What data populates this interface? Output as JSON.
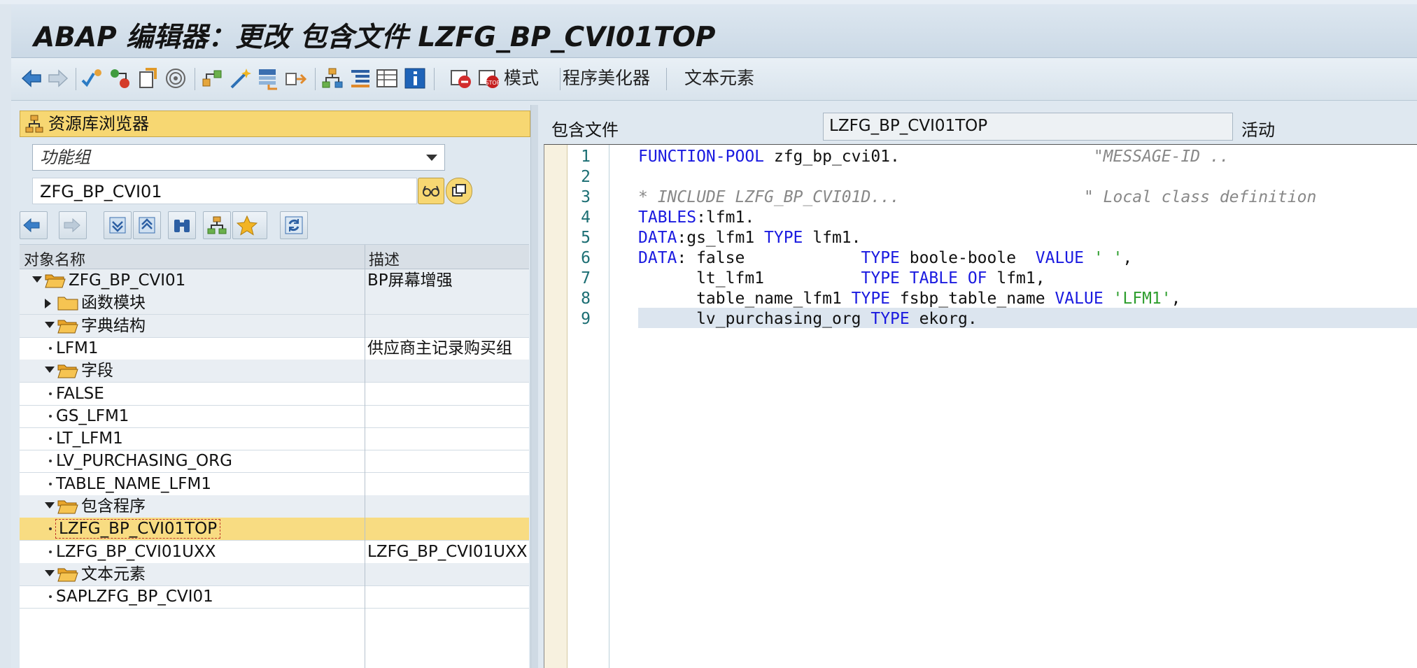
{
  "window": {
    "title": "ABAP 编辑器：更改 包含文件 LZFG_BP_CVI01TOP"
  },
  "toolbar": {
    "icons": [
      "back-arrow-icon",
      "forward-arrow-icon",
      "check-syntax-icon",
      "toggle-display-change-icon",
      "activate-icon",
      "where-used-icon",
      "display-object-list-icon",
      "magic-wand-icon",
      "insert-statement-icon",
      "move-icon",
      "hierarchy-icon",
      "indent-icon",
      "table-view-icon",
      "info-icon",
      "set-breakpoint-icon",
      "stop-breakpoint-icon"
    ],
    "pattern_label": "模式",
    "pretty_printer_label": "程序美化器",
    "text_elements_label": "文本元素"
  },
  "repository_browser": {
    "title": "资源库浏览器",
    "object_type": "功能组",
    "object_name": "ZFG_BP_CVI01",
    "columns": [
      "对象名称",
      "描述"
    ],
    "rows": [
      {
        "level": 0,
        "kind": "folder",
        "expand": "down",
        "name": "ZFG_BP_CVI01",
        "desc": "BP屏幕增强"
      },
      {
        "level": 1,
        "kind": "folder",
        "expand": "right",
        "name": "函数模块",
        "desc": ""
      },
      {
        "level": 1,
        "kind": "folder",
        "expand": "down",
        "name": "字典结构",
        "desc": ""
      },
      {
        "level": 2,
        "kind": "leaf",
        "expand": "",
        "name": "LFM1",
        "desc": "供应商主记录购买组"
      },
      {
        "level": 1,
        "kind": "folder",
        "expand": "down",
        "name": "字段",
        "desc": ""
      },
      {
        "level": 2,
        "kind": "leaf",
        "expand": "",
        "name": "FALSE",
        "desc": ""
      },
      {
        "level": 2,
        "kind": "leaf",
        "expand": "",
        "name": "GS_LFM1",
        "desc": ""
      },
      {
        "level": 2,
        "kind": "leaf",
        "expand": "",
        "name": "LT_LFM1",
        "desc": ""
      },
      {
        "level": 2,
        "kind": "leaf",
        "expand": "",
        "name": "LV_PURCHASING_ORG",
        "desc": ""
      },
      {
        "level": 2,
        "kind": "leaf",
        "expand": "",
        "name": "TABLE_NAME_LFM1",
        "desc": ""
      },
      {
        "level": 1,
        "kind": "folder",
        "expand": "down",
        "name": "包含程序",
        "desc": ""
      },
      {
        "level": 2,
        "kind": "leaf",
        "expand": "",
        "name": "LZFG_BP_CVI01TOP",
        "desc": "",
        "selected": true
      },
      {
        "level": 2,
        "kind": "leaf",
        "expand": "",
        "name": "LZFG_BP_CVI01UXX",
        "desc": "LZFG_BP_CVI01UXX"
      },
      {
        "level": 1,
        "kind": "folder",
        "expand": "down",
        "name": "文本元素",
        "desc": ""
      },
      {
        "level": 2,
        "kind": "leaf",
        "expand": "",
        "name": "SAPLZFG_BP_CVI01",
        "desc": ""
      }
    ]
  },
  "editor": {
    "include_label": "包含文件",
    "include_name": "LZFG_BP_CVI01TOP",
    "status": "活动",
    "line_numbers": [
      "1",
      "2",
      "3",
      "4",
      "5",
      "6",
      "7",
      "8",
      "9"
    ],
    "lines": [
      [
        {
          "t": "FUNCTION-POOL",
          "c": "kw"
        },
        {
          "t": " zfg_bp_cvi01",
          "c": "id"
        },
        {
          "t": ".",
          "c": "pct"
        },
        {
          "t": "                    \"MESSAGE-ID ..",
          "c": "cm"
        }
      ],
      [],
      [
        {
          "t": "* INCLUDE LZFG_BP_CVI01D...                   \" Local class definition",
          "c": "cm"
        }
      ],
      [
        {
          "t": "TABLES",
          "c": "kw"
        },
        {
          "t": ":lfm1.",
          "c": "id"
        }
      ],
      [
        {
          "t": "DATA",
          "c": "kw"
        },
        {
          "t": ":gs_lfm1 ",
          "c": "id"
        },
        {
          "t": "TYPE",
          "c": "kw"
        },
        {
          "t": " lfm1.",
          "c": "id"
        }
      ],
      [
        {
          "t": "DATA",
          "c": "kw"
        },
        {
          "t": ": false            ",
          "c": "id"
        },
        {
          "t": "TYPE",
          "c": "kw"
        },
        {
          "t": " boole-boole  ",
          "c": "id"
        },
        {
          "t": "VALUE",
          "c": "kw"
        },
        {
          "t": " ' '",
          "c": "str"
        },
        {
          "t": ",",
          "c": "pct"
        }
      ],
      [
        {
          "t": "      lt_lfm1          ",
          "c": "id"
        },
        {
          "t": "TYPE TABLE OF",
          "c": "kw"
        },
        {
          "t": " lfm1,",
          "c": "id"
        }
      ],
      [
        {
          "t": "      table_name_lfm1 ",
          "c": "id"
        },
        {
          "t": "TYPE",
          "c": "kw"
        },
        {
          "t": " fsbp_table_name ",
          "c": "id"
        },
        {
          "t": "VALUE",
          "c": "kw"
        },
        {
          "t": " 'LFM1'",
          "c": "str"
        },
        {
          "t": ",",
          "c": "pct"
        }
      ],
      [
        {
          "t": "      lv_purchasing_org ",
          "c": "id"
        },
        {
          "t": "TYPE",
          "c": "kw"
        },
        {
          "t": " ekorg.",
          "c": "id"
        }
      ]
    ]
  }
}
